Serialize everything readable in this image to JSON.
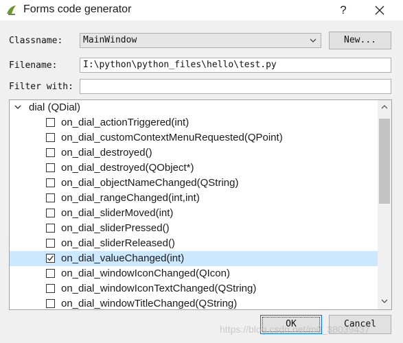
{
  "window": {
    "title": "Forms code generator",
    "help_glyph": "?",
    "app_icon": "qt-designer-icon",
    "close_icon": "close-icon"
  },
  "form": {
    "classname_label": "Classname:",
    "classname_value": "MainWindow",
    "new_button": "New...",
    "filename_label": "Filename:",
    "filename_value": "I:\\python\\python_files\\hello\\test.py",
    "filter_label": "Filter with:",
    "filter_value": ""
  },
  "tree": {
    "parent": {
      "label": "dial (QDial)",
      "expanded": true
    },
    "items": [
      {
        "label": "on_dial_actionTriggered(int)",
        "checked": false,
        "selected": false
      },
      {
        "label": "on_dial_customContextMenuRequested(QPoint)",
        "checked": false,
        "selected": false
      },
      {
        "label": "on_dial_destroyed()",
        "checked": false,
        "selected": false
      },
      {
        "label": "on_dial_destroyed(QObject*)",
        "checked": false,
        "selected": false
      },
      {
        "label": "on_dial_objectNameChanged(QString)",
        "checked": false,
        "selected": false
      },
      {
        "label": "on_dial_rangeChanged(int,int)",
        "checked": false,
        "selected": false
      },
      {
        "label": "on_dial_sliderMoved(int)",
        "checked": false,
        "selected": false
      },
      {
        "label": "on_dial_sliderPressed()",
        "checked": false,
        "selected": false
      },
      {
        "label": "on_dial_sliderReleased()",
        "checked": false,
        "selected": false
      },
      {
        "label": "on_dial_valueChanged(int)",
        "checked": true,
        "selected": true
      },
      {
        "label": "on_dial_windowIconChanged(QIcon)",
        "checked": false,
        "selected": false
      },
      {
        "label": "on_dial_windowIconTextChanged(QString)",
        "checked": false,
        "selected": false
      },
      {
        "label": "on_dial_windowTitleChanged(QString)",
        "checked": false,
        "selected": false
      }
    ]
  },
  "buttons": {
    "ok": "OK",
    "cancel": "Cancel"
  },
  "watermark": "https://blog.csdn.net/m0_38039437",
  "colors": {
    "selection": "#cce8ff",
    "focus_border": "#0078d7"
  }
}
